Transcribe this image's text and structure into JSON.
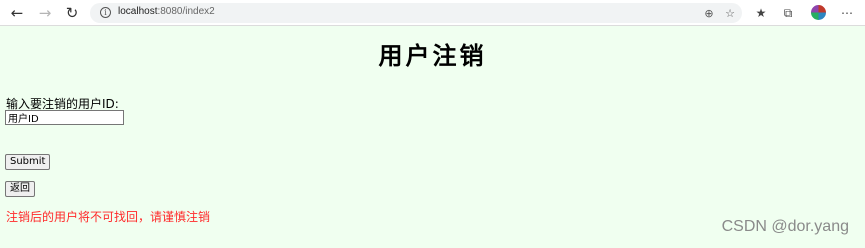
{
  "browser": {
    "url_host": "localhost",
    "url_path": ":8080/index2",
    "icons": {
      "back": "back-arrow-icon",
      "forward": "forward-arrow-icon",
      "reload": "reload-icon",
      "info": "site-info-icon",
      "zoom": "zoom-icon",
      "favorite_add": "add-favorite-icon",
      "favorites": "favorites-icon",
      "collections": "collections-icon",
      "profile": "profile-avatar",
      "menu": "more-menu-icon"
    }
  },
  "page": {
    "title": "用户注销",
    "label": "输入要注销的用户ID:",
    "input_value": "用户ID",
    "submit_label": "Submit",
    "back_label": "返回",
    "warning": "注销后的用户将不可找回，请谨慎注销",
    "watermark": "CSDN @dor.yang"
  },
  "colors": {
    "background": "#f0fff0",
    "warning": "#ff2a2a"
  }
}
